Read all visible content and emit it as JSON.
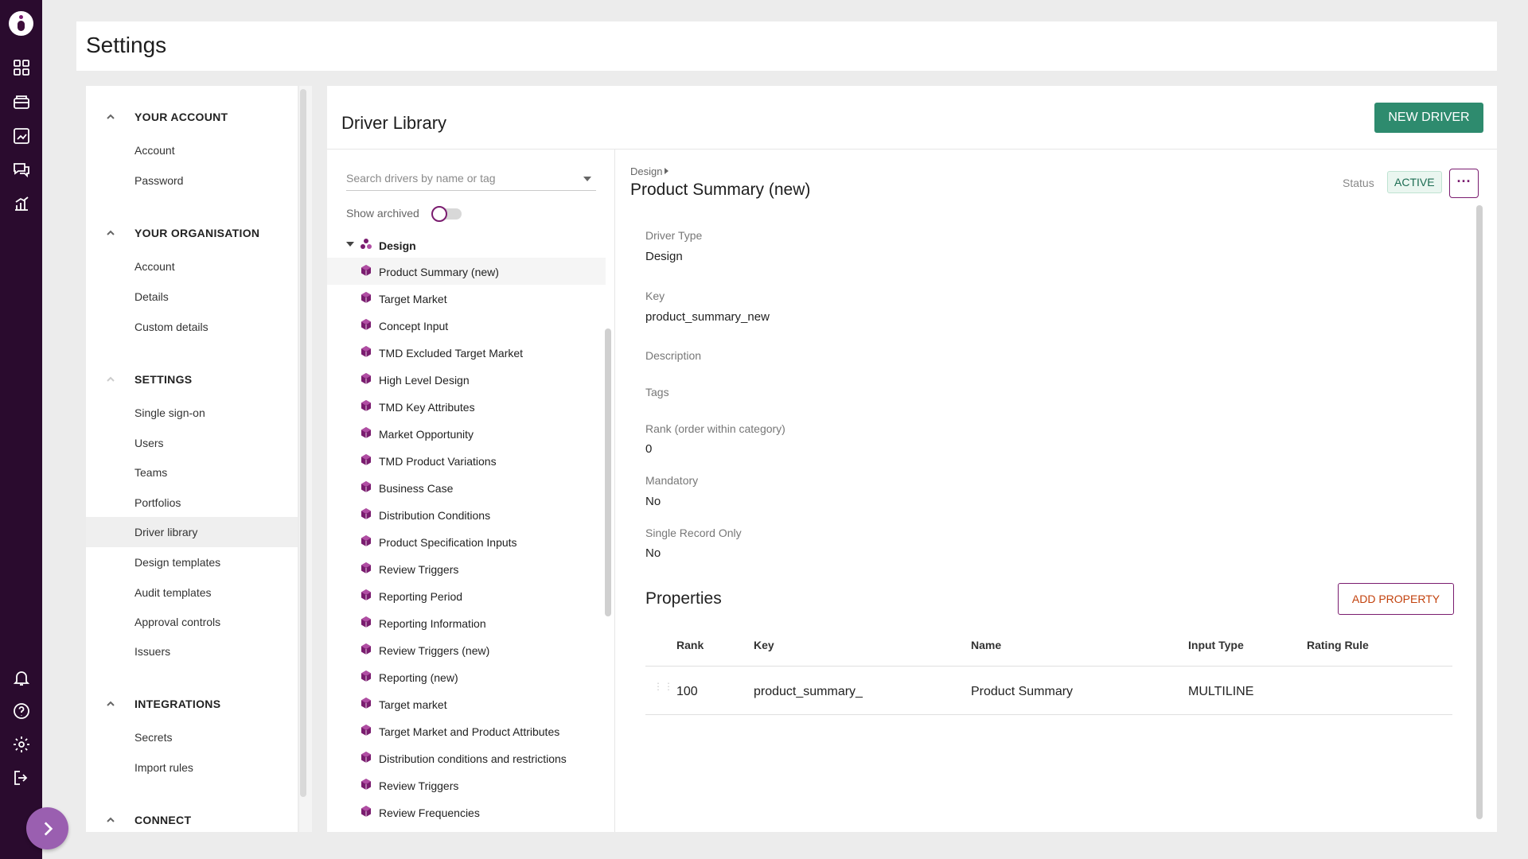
{
  "app": {
    "page_title": "Settings"
  },
  "nav": {
    "sections": [
      {
        "title": "YOUR ACCOUNT",
        "items": [
          "Account",
          "Password"
        ]
      },
      {
        "title": "YOUR ORGANISATION",
        "items": [
          "Account",
          "Details",
          "Custom details"
        ]
      },
      {
        "title": "SETTINGS",
        "items": [
          "Single sign-on",
          "Users",
          "Teams",
          "Portfolios",
          "Driver library",
          "Design templates",
          "Audit templates",
          "Approval controls",
          "Issuers"
        ]
      },
      {
        "title": "INTEGRATIONS",
        "items": [
          "Secrets",
          "Import rules"
        ]
      },
      {
        "title": "CONNECT",
        "items": []
      }
    ],
    "active_item": "Driver library"
  },
  "library": {
    "title": "Driver Library",
    "new_button": "NEW DRIVER",
    "search_placeholder": "Search drivers by name or tag",
    "show_archived_label": "Show archived",
    "tree": {
      "root": "Design",
      "items": [
        "Product Summary (new)",
        "Target Market",
        "Concept Input",
        "TMD Excluded Target Market",
        "High Level Design",
        "TMD Key Attributes",
        "Market Opportunity",
        "TMD Product Variations",
        "Business Case",
        "Distribution Conditions",
        "Product Specification Inputs",
        "Review Triggers",
        "Reporting Period",
        "Reporting Information",
        "Review Triggers (new)",
        "Reporting (new)",
        "Target market",
        "Target Market and Product Attributes",
        "Distribution conditions and restrictions",
        "Review Triggers",
        "Review Frequencies"
      ],
      "selected": "Product Summary (new)"
    }
  },
  "detail": {
    "breadcrumb": "Design",
    "title": "Product Summary (new)",
    "status_label": "Status",
    "status_value": "ACTIVE",
    "more_icon": "ellipsis-icon",
    "fields": [
      {
        "label": "Driver Type",
        "value": "Design"
      },
      {
        "label": "Key",
        "value": "product_summary_new"
      },
      {
        "label": "Description",
        "value": ""
      },
      {
        "label": "Tags",
        "value": ""
      },
      {
        "label": "Rank (order within category)",
        "value": "0"
      },
      {
        "label": "Mandatory",
        "value": "No"
      },
      {
        "label": "Single Record Only",
        "value": "No"
      }
    ],
    "properties": {
      "title": "Properties",
      "add_button": "ADD PROPERTY",
      "columns": [
        "Rank",
        "Key",
        "Name",
        "Input Type",
        "Rating Rule"
      ],
      "rows": [
        {
          "rank": "100",
          "key": "product_summary_",
          "name": "Product Summary",
          "input_type": "MULTILINE",
          "rating_rule": ""
        }
      ]
    }
  },
  "colors": {
    "rail": "#2a0b2e",
    "primary_green": "#2e8b6e",
    "accent_purple": "#7a1c6f",
    "add_text": "#c2410c"
  }
}
